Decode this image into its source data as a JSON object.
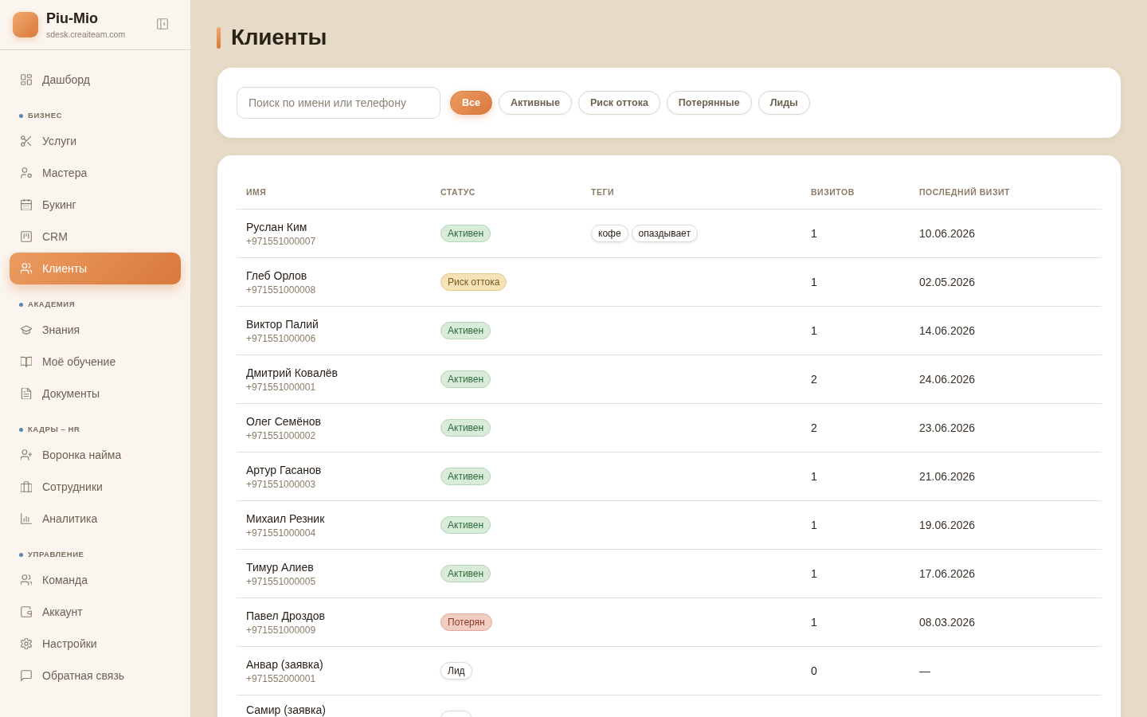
{
  "sidebar": {
    "brand": {
      "name": "Piu-Mio",
      "domain": "sdesk.creaiteam.com"
    },
    "groups": [
      {
        "items": [
          {
            "label": "Дашборд",
            "selected": false
          }
        ]
      },
      {
        "title": "БИЗНЕС",
        "items": [
          {
            "label": "Услуги",
            "selected": false
          },
          {
            "label": "Мастера",
            "selected": false
          },
          {
            "label": "Букинг",
            "selected": false
          },
          {
            "label": "CRM",
            "selected": false
          },
          {
            "label": "Клиенты",
            "selected": true
          }
        ]
      },
      {
        "title": "АКАДЕМИЯ",
        "items": [
          {
            "label": "Знания",
            "selected": false
          },
          {
            "label": "Моё обучение",
            "selected": false
          },
          {
            "label": "Документы",
            "selected": false
          }
        ]
      },
      {
        "title": "КАДРЫ – HR",
        "items": [
          {
            "label": "Воронка найма",
            "selected": false
          },
          {
            "label": "Сотрудники",
            "selected": false
          },
          {
            "label": "Аналитика",
            "selected": false
          }
        ]
      },
      {
        "title": "УПРАВЛЕНИЕ",
        "items": [
          {
            "label": "Команда",
            "selected": false
          },
          {
            "label": "Аккаунт",
            "selected": false
          },
          {
            "label": "Настройки",
            "selected": false
          },
          {
            "label": "Обратная связь",
            "selected": false
          }
        ]
      }
    ]
  },
  "page": {
    "title": "Клиенты"
  },
  "filters": {
    "search": {
      "placeholder": "Поиск по имени или телефону"
    },
    "chips": [
      {
        "label": "Все",
        "selected": true
      },
      {
        "label": "Активные",
        "selected": false
      },
      {
        "label": "Риск оттока",
        "selected": false
      },
      {
        "label": "Потерянные",
        "selected": false
      },
      {
        "label": "Лиды",
        "selected": false
      }
    ]
  },
  "table": {
    "columns": [
      "ИМЯ",
      "СТАТУС",
      "ТЕГИ",
      "ВИЗИТОВ",
      "ПОСЛЕДНИЙ ВИЗИТ"
    ],
    "rows": [
      {
        "name": "Руслан Ким",
        "phone": "+971551000007",
        "status": {
          "kind": "active",
          "label": "Активен"
        },
        "tags": [
          "кофе",
          "опаздывает"
        ],
        "visits": "1",
        "last_visit": "10.06.2026"
      },
      {
        "name": "Глеб Орлов",
        "phone": "+971551000008",
        "status": {
          "kind": "risk",
          "label": "Риск оттока"
        },
        "visits": "1",
        "last_visit": "02.05.2026"
      },
      {
        "name": "Виктор Палий",
        "phone": "+971551000006",
        "status": {
          "kind": "active",
          "label": "Активен"
        },
        "visits": "1",
        "last_visit": "14.06.2026"
      },
      {
        "name": "Дмитрий Ковалёв",
        "phone": "+971551000001",
        "status": {
          "kind": "active",
          "label": "Активен"
        },
        "visits": "2",
        "last_visit": "24.06.2026"
      },
      {
        "name": "Олег Семёнов",
        "phone": "+971551000002",
        "status": {
          "kind": "active",
          "label": "Активен"
        },
        "visits": "2",
        "last_visit": "23.06.2026"
      },
      {
        "name": "Артур Гасанов",
        "phone": "+971551000003",
        "status": {
          "kind": "active",
          "label": "Активен"
        },
        "visits": "1",
        "last_visit": "21.06.2026"
      },
      {
        "name": "Михаил Резник",
        "phone": "+971551000004",
        "status": {
          "kind": "active",
          "label": "Активен"
        },
        "visits": "1",
        "last_visit": "19.06.2026"
      },
      {
        "name": "Тимур Алиев",
        "phone": "+971551000005",
        "status": {
          "kind": "active",
          "label": "Активен"
        },
        "visits": "1",
        "last_visit": "17.06.2026"
      },
      {
        "name": "Павел Дроздов",
        "phone": "+971551000009",
        "status": {
          "kind": "lost",
          "label": "Потерян"
        },
        "visits": "1",
        "last_visit": "08.03.2026"
      },
      {
        "name": "Анвар (заявка)",
        "phone": "+971552000001",
        "status": {
          "kind": "lead",
          "label": "Лид"
        },
        "visits": "0",
        "last_visit": "—"
      },
      {
        "name": "Самир (заявка)",
        "status": {
          "kind": "lead"
        }
      }
    ]
  }
}
